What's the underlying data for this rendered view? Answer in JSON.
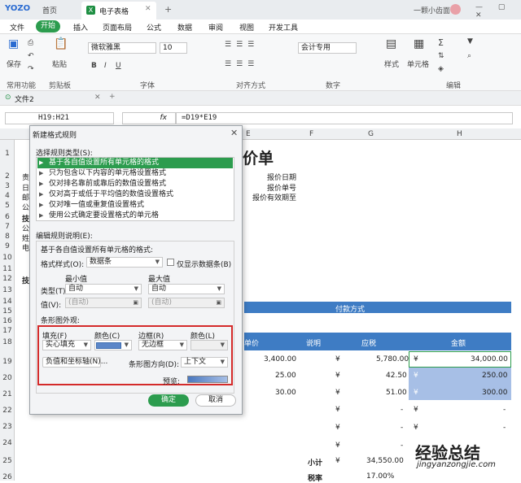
{
  "app": {
    "logo": "YOZO",
    "home": "首页",
    "doc_tab": "电子表格",
    "user": "一颗小齿面",
    "window_buttons": "— ▢ ✕"
  },
  "menu": [
    "文件",
    "开始",
    "插入",
    "页面布局",
    "公式",
    "数据",
    "审阅",
    "视图",
    "开发工具"
  ],
  "ribbon": {
    "save": "保存",
    "paste": "粘贴",
    "font_name": "微软雅黑",
    "font_size": "10",
    "number_format": "会计专用",
    "style": "样式",
    "cells": "单元格",
    "groups": [
      "常用功能",
      "剪贴板",
      "字体",
      "对齐方式",
      "数字",
      "编辑"
    ]
  },
  "sheet_tab": "文件2",
  "formula_bar": {
    "name_box": "H19:H21",
    "fx": "fx",
    "formula": "=D19*E19"
  },
  "columns": [
    "E",
    "F",
    "G",
    "H"
  ],
  "rows": [
    "1",
    "2",
    "3",
    "4",
    "5",
    "6",
    "7",
    "8",
    "9",
    "10",
    "11",
    "12",
    "13",
    "14",
    "15",
    "16",
    "17",
    "18",
    "19",
    "20",
    "21",
    "22",
    "23",
    "24",
    "25",
    "26"
  ],
  "sheet": {
    "title_partial": "价单",
    "labels": [
      "报价日期",
      "报价单号",
      "报价有效期至"
    ],
    "left_stub": [
      "责",
      "日",
      "邮",
      "公",
      "技",
      "公",
      "姓",
      "电",
      "技"
    ],
    "payment": "付款方式",
    "headers": [
      "单价",
      "说明",
      "应税",
      "金额"
    ],
    "prices": [
      "3,400.00",
      "25.00",
      "30.00"
    ],
    "yen": "¥",
    "taxes": [
      "5,780.00",
      "42.50",
      "51.00",
      "-",
      "-",
      "-",
      "-"
    ],
    "amounts": [
      "34,000.00",
      "250.00",
      "300.00",
      "-",
      "-",
      "-",
      "-"
    ],
    "subtotal_label": "小计",
    "subtotal": "34,550.00",
    "taxrate_label": "税率",
    "taxrate": "17.00%"
  },
  "watermark": {
    "text": "经验总结",
    "url": "jingyanzongjie.com"
  },
  "dialog": {
    "title": "新建格式规则",
    "close": "✕",
    "select_type_label": "选择规则类型(S):",
    "rule_types": [
      "基于各自值设置所有单元格的格式",
      "只为包含以下内容的单元格设置格式",
      "仅对排名靠前或靠后的数值设置格式",
      "仅对高于或低于平均值的数值设置格式",
      "仅对唯一值或重复值设置格式",
      "使用公式确定要设置格式的单元格"
    ],
    "edit_label": "编辑规则说明(E):",
    "edit_sub": "基于各自值设置所有单元格的格式:",
    "format_style_label": "格式样式(O):",
    "format_style": "数据条",
    "show_bar_only": "仅显示数据条(B)",
    "min_label": "最小值",
    "max_label": "最大值",
    "type_label": "类型(T):",
    "type_min": "自动",
    "type_max": "自动",
    "value_label": "值(V):",
    "value_min": "(自动)",
    "value_max": "(自动)",
    "bar_appearance": "条形图外观:",
    "fill_label": "填充(F)",
    "color_label": "颜色(C)",
    "border_label": "边框(R)",
    "border_color_label": "颜色(L)",
    "fill_value": "实心填充",
    "border_value": "无边框",
    "axis_button": "负值和坐标轴(N)...",
    "direction_label": "条形图方向(D):",
    "direction_value": "上下文",
    "preview_label": "预览:",
    "ok": "确定",
    "cancel": "取消",
    "bar_color": "#5b86c8"
  }
}
